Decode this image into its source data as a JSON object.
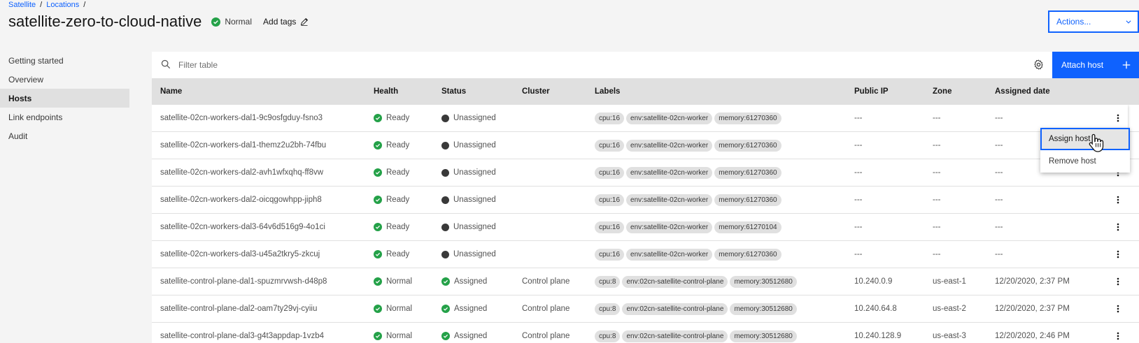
{
  "breadcrumb": {
    "items": [
      "Satellite",
      "Locations"
    ],
    "sep": "/"
  },
  "header": {
    "title": "satellite-zero-to-cloud-native",
    "status": "Normal",
    "add_tags": "Add tags",
    "actions": "Actions..."
  },
  "sidebar": {
    "items": [
      {
        "label": "Getting started"
      },
      {
        "label": "Overview"
      },
      {
        "label": "Hosts",
        "active": true
      },
      {
        "label": "Link endpoints"
      },
      {
        "label": "Audit"
      }
    ]
  },
  "toolbar": {
    "filter_placeholder": "Filter table",
    "attach_label": "Attach host"
  },
  "table": {
    "columns": [
      "Name",
      "Health",
      "Status",
      "Cluster",
      "Labels",
      "Public IP",
      "Zone",
      "Assigned date"
    ],
    "rows": [
      {
        "name": "satellite-02cn-workers-dal1-9c9osfgduy-fsno3",
        "health": "Ready",
        "status": "Unassigned",
        "cluster": "",
        "labels": [
          "cpu:16",
          "env:satellite-02cn-worker",
          "memory:61270360"
        ],
        "ip": "---",
        "zone": "---",
        "date": "---"
      },
      {
        "name": "satellite-02cn-workers-dal1-themz2u2bh-74fbu",
        "health": "Ready",
        "status": "Unassigned",
        "cluster": "",
        "labels": [
          "cpu:16",
          "env:satellite-02cn-worker",
          "memory:61270360"
        ],
        "ip": "---",
        "zone": "---",
        "date": "---"
      },
      {
        "name": "satellite-02cn-workers-dal2-avh1wfxqhq-ff8vw",
        "health": "Ready",
        "status": "Unassigned",
        "cluster": "",
        "labels": [
          "cpu:16",
          "env:satellite-02cn-worker",
          "memory:61270360"
        ],
        "ip": "---",
        "zone": "---",
        "date": "---"
      },
      {
        "name": "satellite-02cn-workers-dal2-oicqgowhpp-jiph8",
        "health": "Ready",
        "status": "Unassigned",
        "cluster": "",
        "labels": [
          "cpu:16",
          "env:satellite-02cn-worker",
          "memory:61270360"
        ],
        "ip": "---",
        "zone": "---",
        "date": "---"
      },
      {
        "name": "satellite-02cn-workers-dal3-64v6d516g9-4o1ci",
        "health": "Ready",
        "status": "Unassigned",
        "cluster": "",
        "labels": [
          "cpu:16",
          "env:satellite-02cn-worker",
          "memory:61270104"
        ],
        "ip": "---",
        "zone": "---",
        "date": "---"
      },
      {
        "name": "satellite-02cn-workers-dal3-u45a2tkry5-zkcuj",
        "health": "Ready",
        "status": "Unassigned",
        "cluster": "",
        "labels": [
          "cpu:16",
          "env:satellite-02cn-worker",
          "memory:61270360"
        ],
        "ip": "---",
        "zone": "---",
        "date": "---"
      },
      {
        "name": "satellite-control-plane-dal1-spuzmrvwsh-d48p8",
        "health": "Normal",
        "status": "Assigned",
        "cluster": "Control plane",
        "labels": [
          "cpu:8",
          "env:02cn-satellite-control-plane",
          "memory:30512680"
        ],
        "ip": "10.240.0.9",
        "zone": "us-east-1",
        "date": "12/20/2020, 2:37 PM"
      },
      {
        "name": "satellite-control-plane-dal2-oam7ty29vj-cyiiu",
        "health": "Normal",
        "status": "Assigned",
        "cluster": "Control plane",
        "labels": [
          "cpu:8",
          "env:02cn-satellite-control-plane",
          "memory:30512680"
        ],
        "ip": "10.240.64.8",
        "zone": "us-east-2",
        "date": "12/20/2020, 2:37 PM"
      },
      {
        "name": "satellite-control-plane-dal3-g4t3appdap-1vzb4",
        "health": "Normal",
        "status": "Assigned",
        "cluster": "Control plane",
        "labels": [
          "cpu:8",
          "env:02cn-satellite-control-plane",
          "memory:30512680"
        ],
        "ip": "10.240.128.9",
        "zone": "us-east-3",
        "date": "12/20/2020, 2:46 PM"
      }
    ]
  },
  "overflow_menu": {
    "items": [
      "Assign host",
      "Remove host"
    ]
  },
  "icons": {
    "search": "search-icon",
    "settings": "gear-icon",
    "add": "plus-icon",
    "edit": "pencil-icon",
    "chevron": "chevron-down-icon",
    "overflow": "overflow-menu-icon",
    "ok": "checkmark-circle-icon",
    "dot": "status-dot-icon",
    "cursor": "hand-pointer-icon"
  },
  "colors": {
    "accent": "#0f62fe",
    "success": "#24a148",
    "neutral_dot": "#393939",
    "tag_bg": "#e0e0e0"
  }
}
